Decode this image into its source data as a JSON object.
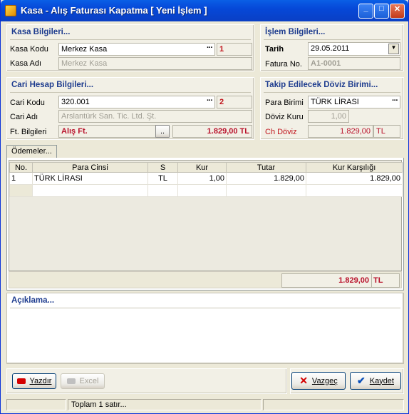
{
  "window": {
    "title": "Kasa - Alış Faturası Kapatma  [ Yeni İşlem ]"
  },
  "kasa": {
    "title": "Kasa Bilgileri...",
    "kodu_label": "Kasa Kodu",
    "kodu_value": "Merkez Kasa",
    "kodu_index": "1",
    "adi_label": "Kasa Adı",
    "adi_value": "Merkez Kasa"
  },
  "islem": {
    "title": "İşlem Bilgileri...",
    "tarih_label": "Tarih",
    "tarih_value": "29.05.2011",
    "fatura_label": "Fatura No.",
    "fatura_value": "A1-0001"
  },
  "cari": {
    "title": "Cari Hesap Bilgileri...",
    "kodu_label": "Cari Kodu",
    "kodu_value": "320.001",
    "kodu_index": "2",
    "adi_label": "Cari Adı",
    "adi_value": "Arslantürk San. Tic. Ltd. Şt.",
    "ft_label": "Ft. Bilgileri",
    "ft_value": "Alış Ft.",
    "ft_btn": "..",
    "ft_amount": "1.829,00 TL"
  },
  "doviz": {
    "title": "Takip Edilecek Döviz Birimi...",
    "para_label": "Para Birimi",
    "para_value": "TÜRK LİRASI",
    "kur_label": "Döviz Kuru",
    "kur_value": "1,00",
    "ch_label": "Ch Döviz",
    "ch_value": "1.829,00",
    "ch_cur": "TL"
  },
  "odemeler": {
    "tab": "Ödemeler...",
    "headers": [
      "No.",
      "Para Cinsi",
      "S",
      "Kur",
      "Tutar",
      "Kur Karşılığı"
    ],
    "rows": [
      [
        "1",
        "TÜRK LİRASI",
        "TL",
        "1,00",
        "1.829,00",
        "1.829,00"
      ]
    ],
    "total": "1.829,00",
    "total_cur": "TL"
  },
  "aciklama": {
    "title": "Açıklama..."
  },
  "buttons": {
    "yazdir": "Yazdır",
    "excel": "Excel",
    "vazgec": "Vazgeç",
    "kaydet": "Kaydet"
  },
  "status": {
    "text": "Toplam 1 satır..."
  }
}
